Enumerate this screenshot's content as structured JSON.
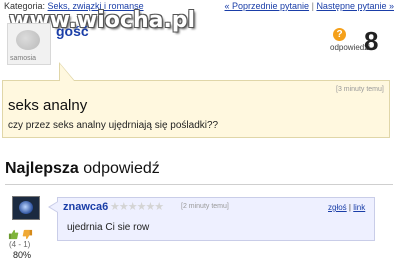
{
  "topbar": {
    "category_prefix": "Kategoria:",
    "category_link": "Seks, związki i romanse",
    "prev_label": "« Poprzednie pytanie",
    "separator": "|",
    "next_label": "Następne pytanie »"
  },
  "watermark": "www.wiocha.pl",
  "asker": {
    "name": "gość",
    "avatar_brand": "samosia"
  },
  "answers_count": {
    "icon": "question-icon",
    "label": "odpowiedzi",
    "value": "8"
  },
  "question": {
    "time": "[3 minuty temu]",
    "title": "seks analny",
    "body": "czy przez seks analny ujędrniają się pośladki??"
  },
  "best_answer": {
    "heading_bold": "Najlepsza",
    "heading_rest": "odpowiedź",
    "author": "znawca6",
    "stars": "★★★★★★",
    "time": "[2 minuty temu]",
    "report_label": "zgłoś",
    "link_label": "link",
    "text": "ujedrnia Ci sie row",
    "votes": "(4 - 1)",
    "percent": "80%"
  },
  "colors": {
    "link": "#1a3ea8",
    "question_bg": "#fff8df",
    "answer_bg": "#eef0ff",
    "icon_orange": "#f5a01a"
  }
}
